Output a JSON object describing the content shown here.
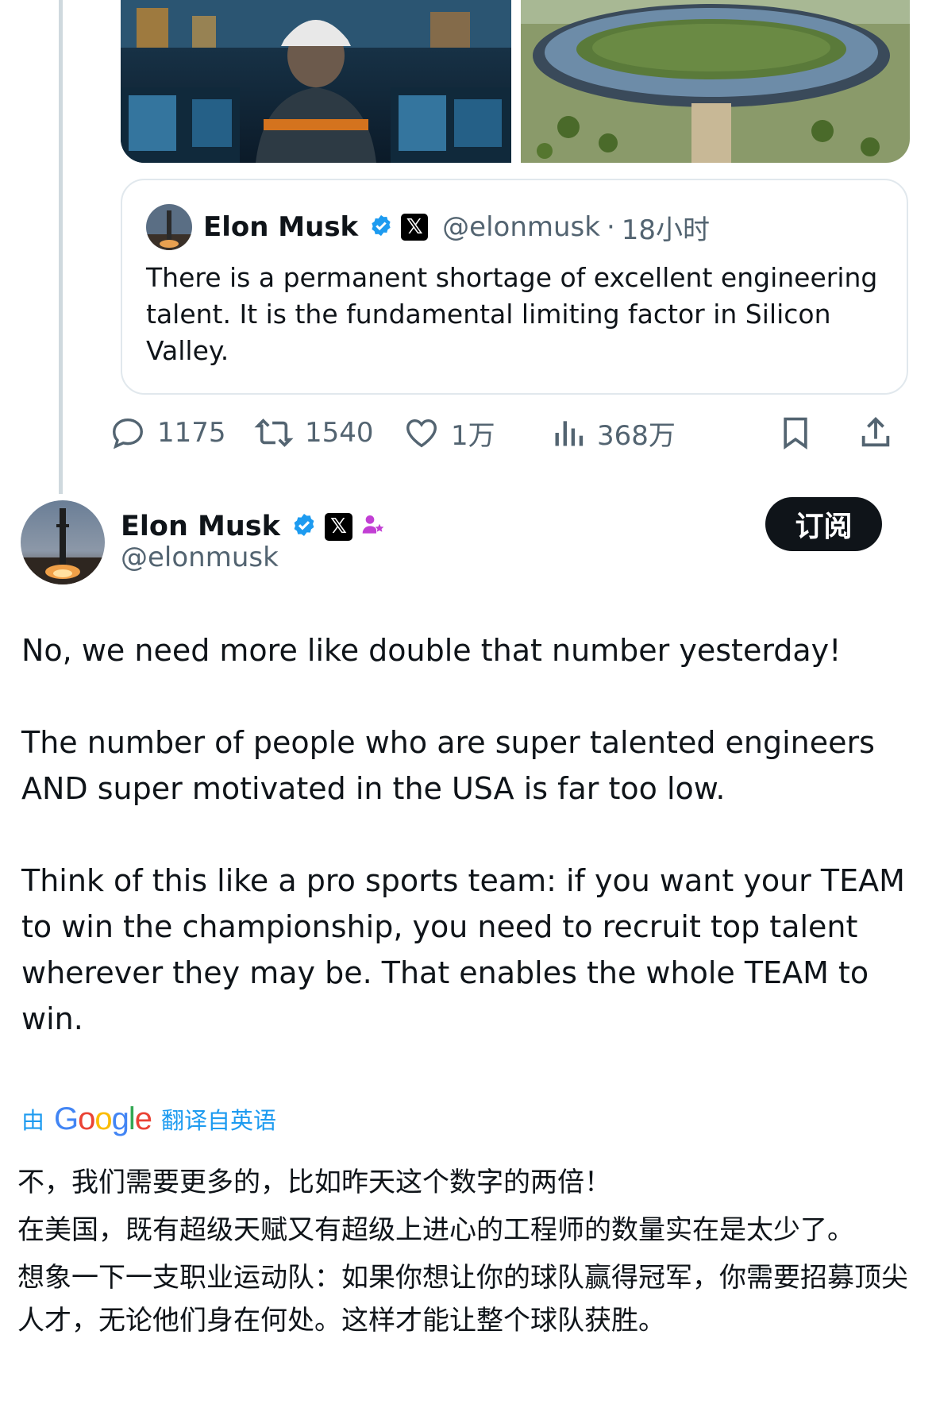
{
  "colors": {
    "accent": "#1d9bf0",
    "text": "#0f1419",
    "muted": "#536471",
    "verified": "#1d9bf0",
    "button_bg": "#0f1419"
  },
  "quoted_tweet": {
    "name": "Elon Musk",
    "handle": "@elonmusk",
    "time_sep": "·",
    "time": "18小时",
    "text": "There is a permanent shortage of excellent engineering talent. It is the fundamental limiting factor in Silicon Valley."
  },
  "actions": {
    "reply_count": "1175",
    "retweet_count": "1540",
    "like_count": "1万",
    "view_count": "368万"
  },
  "tweet": {
    "name": "Elon Musk",
    "handle": "@elonmusk",
    "subscribe_label": "订阅",
    "paragraphs": [
      "No, we need more like double that number yesterday!",
      "The number of people who are super talented engineers AND super motivated in the USA is far too low.",
      "Think of this like a pro sports team: if you want your TEAM to win the championship, you need to recruit top talent wherever they may be. That enables the whole TEAM to win."
    ]
  },
  "translation": {
    "prefix": "由",
    "provider": "Google",
    "suffix": "翻译自英语",
    "lines": [
      "不，我们需要更多的，比如昨天这个数字的两倍！",
      "在美国，既有超级天赋又有超级上进心的工程师的数量实在是太少了。",
      "想象一下一支职业运动队：如果你想让你的球队赢得冠军，你需要招募顶尖人才，无论他们身在何处。这样才能让整个球队获胜。"
    ]
  },
  "icons": [
    "reply-icon",
    "retweet-icon",
    "like-icon",
    "views-icon",
    "bookmark-icon",
    "share-icon",
    "verified-icon",
    "x-logo-icon",
    "affiliate-icon"
  ]
}
